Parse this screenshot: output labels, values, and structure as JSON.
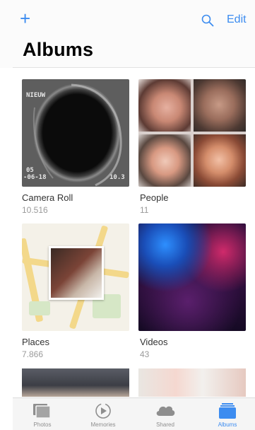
{
  "nav": {
    "add_symbol": "+",
    "edit_label": "Edit",
    "title": "Albums",
    "accent_color": "#3c8cf0"
  },
  "albums": [
    {
      "name": "Camera Roll",
      "count": "10.516",
      "thumb_text_top": "NIEUW",
      "thumb_text_date1": "05",
      "thumb_text_date2": "-06-18",
      "thumb_text_corner": "10.3"
    },
    {
      "name": "People",
      "count": "11"
    },
    {
      "name": "Places",
      "count": "7.866"
    },
    {
      "name": "Videos",
      "count": "43"
    }
  ],
  "tabs": [
    {
      "label": "Photos",
      "icon": "photos-icon"
    },
    {
      "label": "Memories",
      "icon": "memories-icon"
    },
    {
      "label": "Shared",
      "icon": "cloud-icon"
    },
    {
      "label": "Albums",
      "icon": "albums-icon",
      "active": true
    }
  ]
}
